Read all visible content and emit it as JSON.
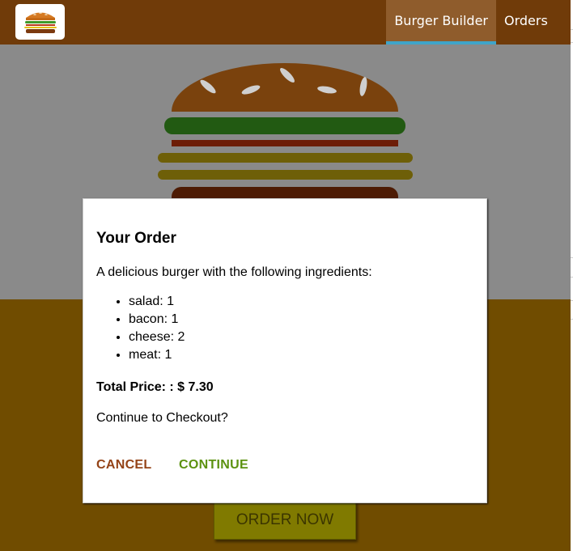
{
  "toolbar": {
    "nav": [
      {
        "label": "Burger Builder",
        "active": true
      },
      {
        "label": "Orders",
        "active": false
      }
    ]
  },
  "controls": {
    "order_now_label": "ORDER NOW"
  },
  "modal": {
    "title": "Your Order",
    "intro": "A delicious burger with the following ingredients:",
    "ingredients": [
      {
        "text": "salad: 1"
      },
      {
        "text": "bacon: 1"
      },
      {
        "text": "cheese: 2"
      },
      {
        "text": "meat: 1"
      }
    ],
    "total": "Total Price: : $ 7.30",
    "question": "Continue to Checkout?",
    "cancel_label": "CANCEL",
    "continue_label": "CONTINUE"
  },
  "colors": {
    "toolbar": "#703b09",
    "cancel": "#944317",
    "continue": "#5c9210",
    "active_underline": "#40a4c8"
  }
}
